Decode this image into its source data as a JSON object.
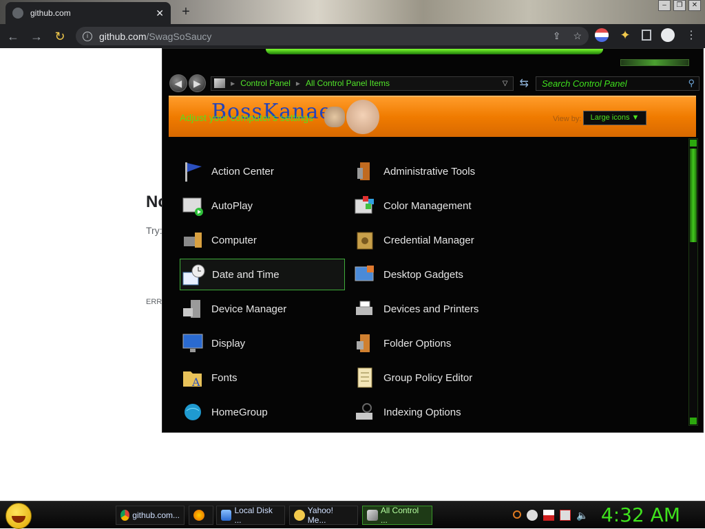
{
  "browser": {
    "tab_title": "github.com",
    "new_tab_glyph": "+",
    "url_domain": "github.com",
    "url_path": "/SwagSoSaucy"
  },
  "page": {
    "heading": "No",
    "try_text": "Try:",
    "error_code": "ERR_"
  },
  "control_panel": {
    "breadcrumbs": [
      "Control Panel",
      "All Control Panel Items"
    ],
    "search_placeholder": "Search Control Panel",
    "banner_brand": "BossKanae",
    "banner_subtitle": "Adjust your computer's settings",
    "view_by_label": "View by:",
    "view_by_value": "Large icons ▼",
    "items": [
      {
        "label": "Action Center",
        "icon": "flag-icon"
      },
      {
        "label": "Administrative Tools",
        "icon": "admin-tools-icon"
      },
      {
        "label": "AutoPlay",
        "icon": "autoplay-icon"
      },
      {
        "label": "Color Management",
        "icon": "color-management-icon"
      },
      {
        "label": "Computer",
        "icon": "computer-icon"
      },
      {
        "label": "Credential Manager",
        "icon": "credential-vault-icon"
      },
      {
        "label": "Date and Time",
        "icon": "clock-calendar-icon"
      },
      {
        "label": "Desktop Gadgets",
        "icon": "gadgets-icon"
      },
      {
        "label": "Device Manager",
        "icon": "device-manager-icon"
      },
      {
        "label": "Devices and Printers",
        "icon": "printer-icon"
      },
      {
        "label": "Display",
        "icon": "monitor-icon"
      },
      {
        "label": "Folder Options",
        "icon": "folder-options-icon"
      },
      {
        "label": "Fonts",
        "icon": "fonts-folder-icon"
      },
      {
        "label": "Group Policy Editor",
        "icon": "policy-document-icon"
      },
      {
        "label": "HomeGroup",
        "icon": "homegroup-globe-icon"
      },
      {
        "label": "Indexing Options",
        "icon": "indexing-icon"
      }
    ],
    "selected_item": "Date and Time"
  },
  "taskbar": {
    "tasks": [
      {
        "label": "github.com...",
        "icon": "chrome-icon",
        "active": false
      },
      {
        "label": "",
        "icon": "firefox-icon",
        "active": false
      },
      {
        "label": "Local Disk ...",
        "icon": "explorer-icon",
        "active": false
      },
      {
        "label": "Yahoo! Me...",
        "icon": "yahoo-messenger-icon",
        "active": false
      },
      {
        "label": "All Control ...",
        "icon": "control-panel-icon",
        "active": true
      }
    ],
    "clock": "4:32 AM"
  },
  "colors": {
    "accent_green": "#3fe21d",
    "banner_orange": "#f07b00",
    "window_bg": "#050505"
  }
}
